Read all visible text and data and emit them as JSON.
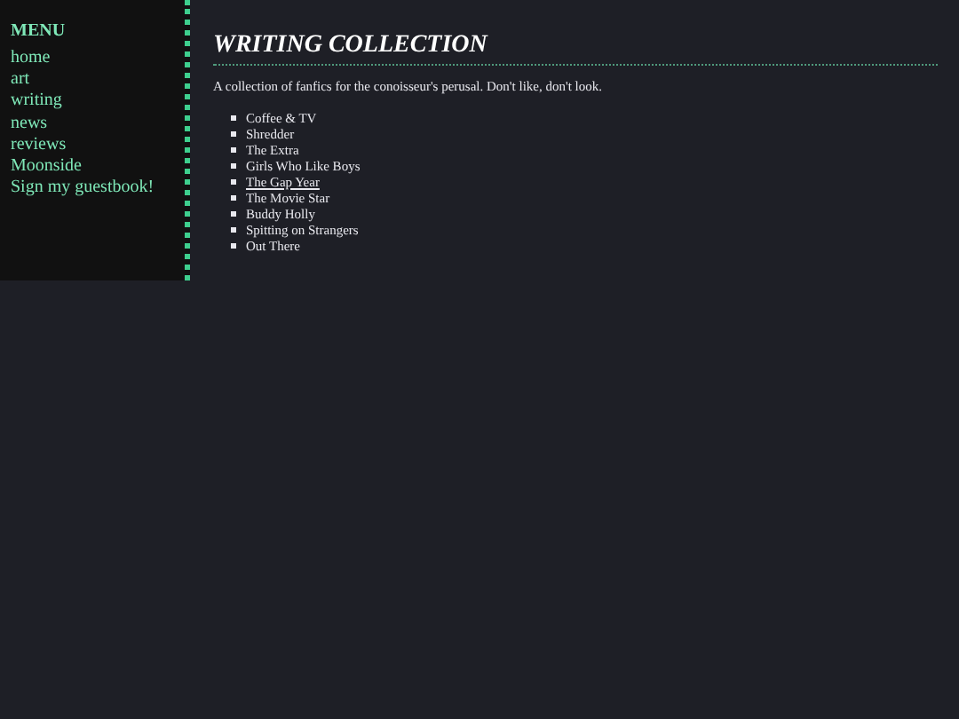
{
  "menu": {
    "title": "MENU",
    "items": [
      {
        "label": "home"
      },
      {
        "label": "art"
      },
      {
        "label": "writing"
      },
      {
        "label": "news"
      },
      {
        "label": "reviews"
      },
      {
        "label": "Moonside"
      },
      {
        "label": "Sign my guestbook!"
      }
    ]
  },
  "page": {
    "title": "WRITING COLLECTION",
    "intro": "A collection of fanfics for the conoisseur's perusal. Don't like, don't look.",
    "stories": [
      {
        "title": "Coffee & TV",
        "hovered": false
      },
      {
        "title": "Shredder",
        "hovered": false
      },
      {
        "title": "The Extra",
        "hovered": false
      },
      {
        "title": "Girls Who Like Boys",
        "hovered": false
      },
      {
        "title": "The Gap Year",
        "hovered": true
      },
      {
        "title": "The Movie Star",
        "hovered": false
      },
      {
        "title": "Buddy Holly",
        "hovered": false
      },
      {
        "title": "Spitting on Strangers",
        "hovered": false
      },
      {
        "title": "Out There",
        "hovered": false
      }
    ]
  }
}
